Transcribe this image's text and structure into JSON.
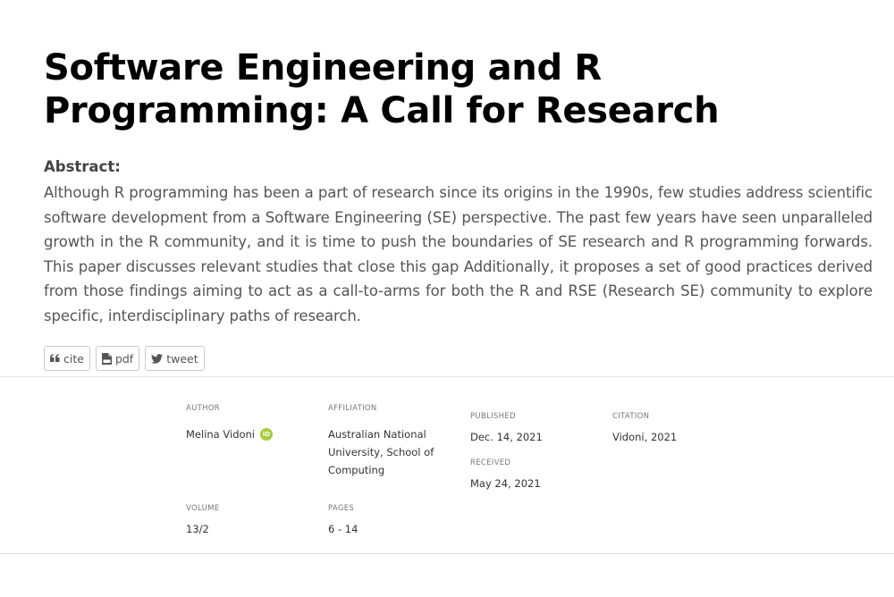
{
  "title": "Software Engineering and R Programming: A Call for Research",
  "abstract": {
    "label": "Abstract:",
    "text": "Although R programming has been a part of research since its origins in the 1990s, few studies address scientific software development from a Software Engineering (SE) perspective. The past few years have seen unparalleled growth in the R community, and it is time to push the boundaries of SE research and R programming forwards. This paper discusses relevant studies that close this gap Additionally, it proposes a set of good practices derived from those findings aiming to act as a call-to-arms for both the R and RSE (Research SE) community to explore specific, interdisciplinary paths of research."
  },
  "share": {
    "cite": {
      "label": "cite",
      "icon": "quote-icon"
    },
    "pdf": {
      "label": "pdf",
      "icon": "pdf-file-icon"
    },
    "tweet": {
      "label": "tweet",
      "icon": "twitter-icon"
    }
  },
  "meta": {
    "author": {
      "label": "Author",
      "value": "Melina Vidoni",
      "icon": "orcid-icon",
      "icon_text": "iD"
    },
    "affiliation": {
      "label": "Affiliation",
      "value": "Australian National University, School of Computing"
    },
    "published": {
      "label": "Published",
      "value": "Dec. 14, 2021"
    },
    "received": {
      "label": "Received",
      "value": "May 24, 2021"
    },
    "citation": {
      "label": "Citation",
      "value": "Vidoni, 2021"
    },
    "volume": {
      "label": "Volume",
      "value": "13/2"
    },
    "pages": {
      "label": "Pages",
      "value": "6 - 14"
    }
  },
  "colors": {
    "orcid_green": "#a6ce39",
    "title": "#000000",
    "body_text": "#555555"
  }
}
